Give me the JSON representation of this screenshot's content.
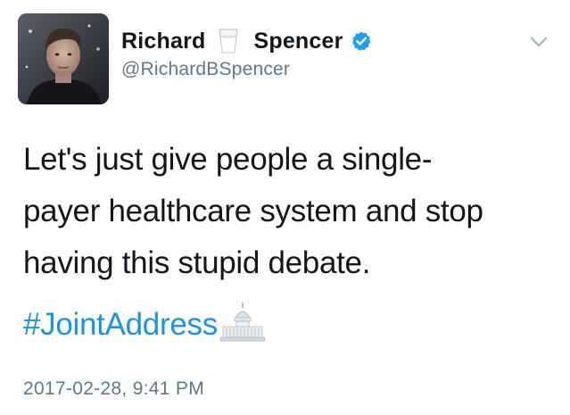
{
  "author": {
    "name_first": "Richard",
    "name_last": "Spencer",
    "name_emoji": "milk-glass-icon",
    "handle": "@RichardBSpencer",
    "verified": true
  },
  "tweet": {
    "text_lines": [
      "Let's just give people a single-",
      "payer healthcare system and stop",
      "having this stupid debate."
    ],
    "hashtag": "#JointAddress",
    "hashtag_emoji": "capitol-building-icon",
    "timestamp": "2017-02-28, 9:41 PM"
  },
  "colors": {
    "text": "#14171a",
    "secondary": "#657786",
    "link": "#1b95e0",
    "verified": "#1da1f2"
  },
  "icons": {
    "menu": "chevron-down-icon",
    "verified": "verified-badge-icon"
  }
}
